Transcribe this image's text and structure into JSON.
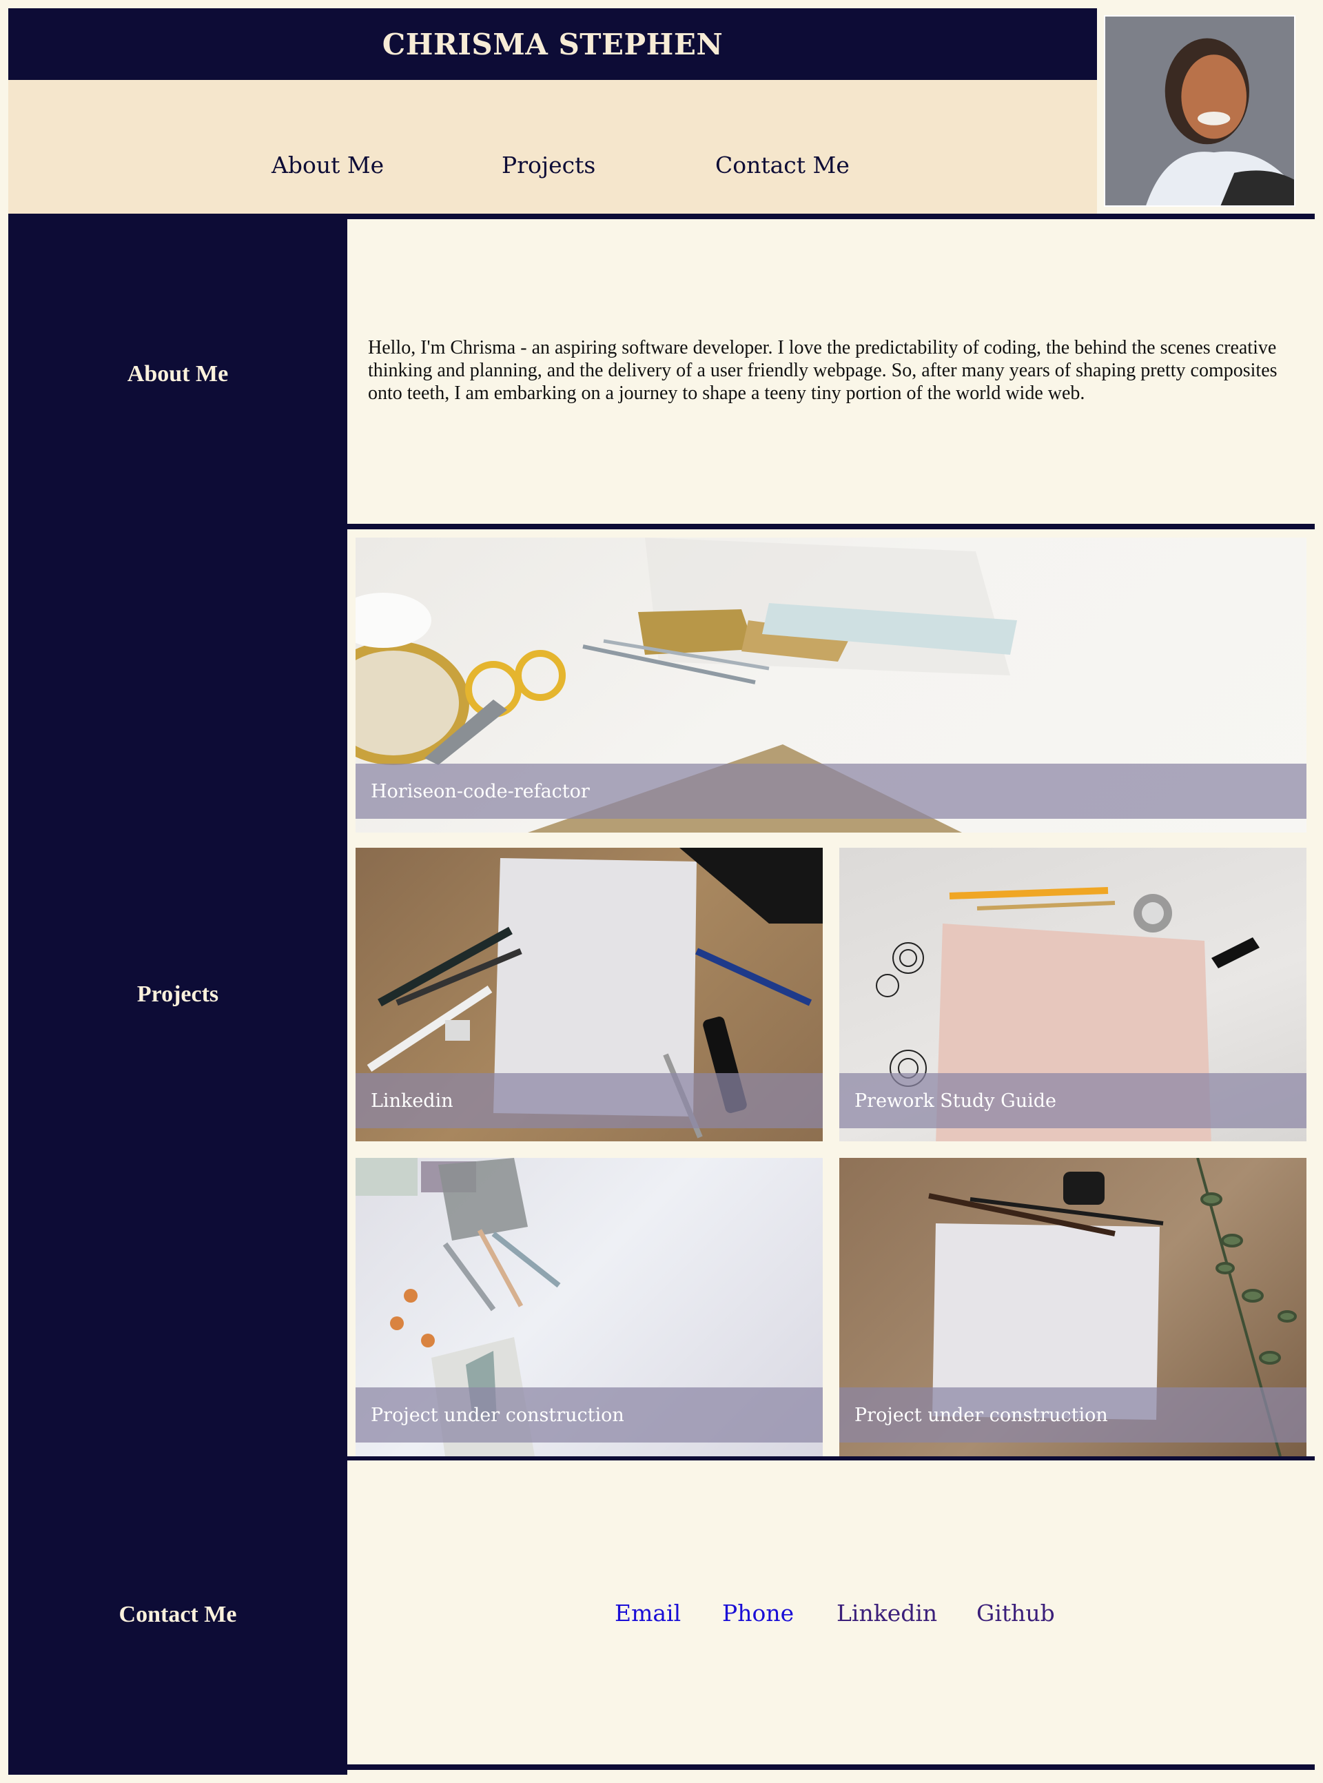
{
  "header": {
    "name": "CHRISMA STEPHEN",
    "nav": [
      "About Me",
      "Projects",
      "Contact Me"
    ]
  },
  "sidebar": {
    "about_label": "About Me",
    "projects_label": "Projects",
    "contact_label": "Contact Me"
  },
  "about": {
    "text": "Hello, I'm Chrisma - an aspiring software developer. I love the predictability of coding, the behind the scenes creative thinking and planning, and the delivery of a user friendly webpage. So, after many years of shaping pretty composites onto teeth, I am embarking on a journey to shape a teeny tiny portion of the world wide web."
  },
  "projects": [
    {
      "title": "Horiseon-code-refactor"
    },
    {
      "title": "Linkedin"
    },
    {
      "title": "Prework Study Guide"
    },
    {
      "title": "Project under construction"
    },
    {
      "title": "Project under construction"
    }
  ],
  "contact": {
    "links": [
      "Email",
      "Phone",
      "Linkedin",
      "Github"
    ]
  },
  "colors": {
    "navy": "#0d0c36",
    "cream": "#faf6e8",
    "tan": "#f5e6cc",
    "link_blue": "#1a0ed6",
    "link_purple": "#3b1f7a"
  }
}
